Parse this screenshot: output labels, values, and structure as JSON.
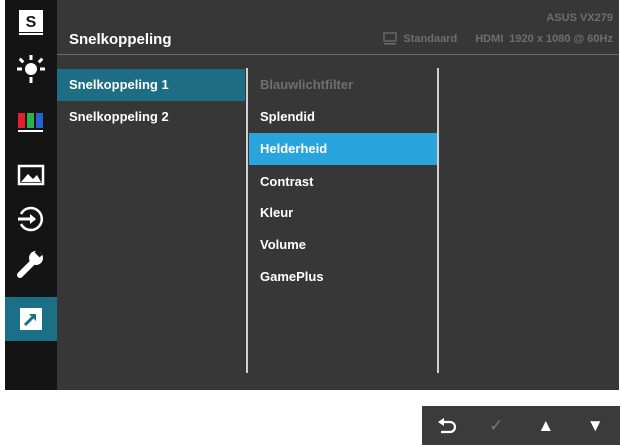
{
  "header": {
    "title": "Snelkoppeling",
    "model": "ASUS VX279",
    "mode": "Standaard",
    "input": "HDMI",
    "resolution": "1920 x 1080 @ 60Hz"
  },
  "sidebar": {
    "items": [
      {
        "icon": "splendid-s-icon"
      },
      {
        "icon": "blue-light-filter-icon"
      },
      {
        "icon": "color-bars-icon"
      },
      {
        "icon": "image-icon"
      },
      {
        "icon": "input-select-icon"
      },
      {
        "icon": "wrench-system-icon"
      },
      {
        "icon": "shortcut-arrow-icon",
        "active": true
      }
    ]
  },
  "submenu": {
    "items": [
      {
        "label": "Snelkoppeling 1",
        "selected": true
      },
      {
        "label": "Snelkoppeling 2"
      }
    ]
  },
  "options": {
    "items": [
      {
        "label": "Blauwlichtfilter",
        "disabled": true
      },
      {
        "label": "Splendid"
      },
      {
        "label": "Helderheid",
        "selected": true
      },
      {
        "label": "Contrast"
      },
      {
        "label": "Kleur"
      },
      {
        "label": "Volume"
      },
      {
        "label": "GamePlus"
      }
    ]
  },
  "keys": {
    "back": "⮌",
    "ok": "✓",
    "up": "▲",
    "down": "▼"
  },
  "colors": {
    "active_sidebar": "#1b6f87",
    "selected_submenu": "#1d6d84",
    "selected_option": "#2aa4dc"
  }
}
